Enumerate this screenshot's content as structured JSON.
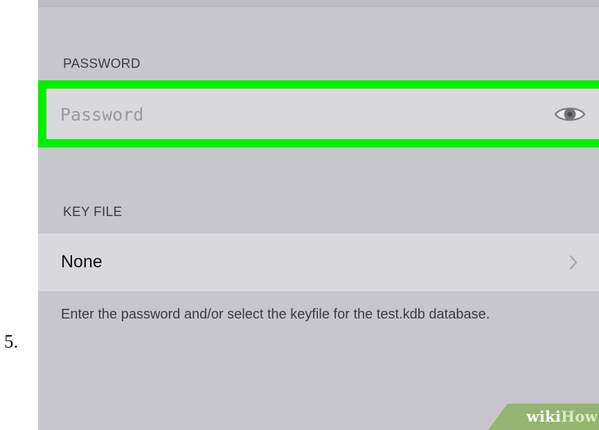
{
  "step_number": "5.",
  "password_section": {
    "header": "PASSWORD",
    "placeholder": "Password",
    "value": "",
    "icon": "eye-icon",
    "highlight_color": "#00f000"
  },
  "keyfile_section": {
    "header": "KEY FILE",
    "value": "None",
    "icon": "chevron-right-icon"
  },
  "helper_text": "Enter the password and/or select the keyfile for the test.kdb database.",
  "watermark": {
    "part1": "wiki",
    "part2": "How"
  },
  "colors": {
    "background": "#c7c6cc",
    "field_background": "#d9d8dd",
    "highlight": "#00f000",
    "watermark_green": "#93b56f"
  }
}
